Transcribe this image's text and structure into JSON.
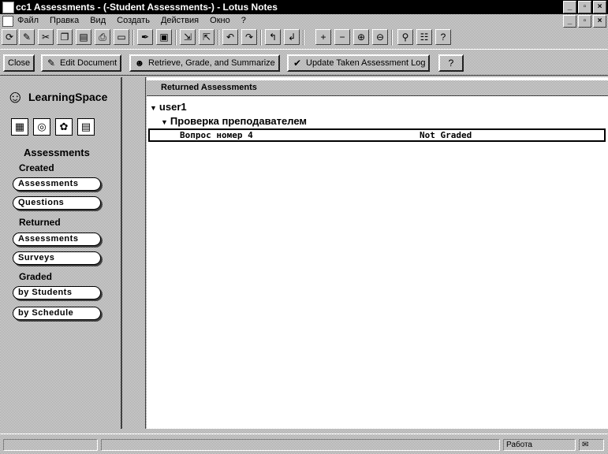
{
  "window": {
    "title": "cc1 Assessments - (-Student Assessments-) - Lotus Notes",
    "min_icon": "minimize-icon",
    "max_icon": "restore-icon",
    "close_icon": "close-icon"
  },
  "menubar": {
    "items": [
      "Файл",
      "Правка",
      "Вид",
      "Создать",
      "Действия",
      "Окно",
      "?"
    ]
  },
  "toolbar": {
    "icons": [
      "refresh-icon",
      "edit-icon",
      "cut-icon",
      "copy-icon",
      "paste-icon",
      "print-icon",
      "open-icon",
      "pen-icon",
      "folder-icon",
      "forward-icon",
      "reply-icon",
      "expand-icon",
      "collapse-icon",
      "prev-icon",
      "next-icon",
      "plus-icon",
      "minus-icon",
      "expand-all-icon",
      "collapse-all-icon",
      "search-icon",
      "properties-icon",
      "help-icon"
    ]
  },
  "actionbar": {
    "buttons": [
      {
        "label": "Close",
        "icon": ""
      },
      {
        "label": "Edit Document",
        "icon": "edit-document-icon"
      },
      {
        "label": "Retrieve, Grade, and Summarize",
        "icon": "grade-icon"
      },
      {
        "label": "Update Taken Assessment Log",
        "icon": "checkmark-icon"
      },
      {
        "label": "",
        "icon": "help-icon"
      }
    ]
  },
  "leftnav": {
    "logo_text": "LearningSpace",
    "icons": [
      "schedule-icon",
      "media-icon",
      "course-room-icon",
      "profiles-icon"
    ],
    "heading": "Assessments",
    "groups": {
      "created": "Created",
      "returned": "Returned",
      "graded": "Graded"
    },
    "pills": {
      "created_assessments": "Assessments",
      "questions": "Questions",
      "returned_assessments": "Assessments",
      "surveys": "Surveys",
      "by_students": "by Students",
      "by_schedule": "by Schedule"
    }
  },
  "view": {
    "column_header": "Returned Assessments",
    "category_user": "user1",
    "category_review": "Проверка преподавателем",
    "doc": {
      "question": "Вопрос номер 4",
      "status": "Not Graded"
    }
  },
  "statusbar": {
    "mail_label": "Работа"
  }
}
